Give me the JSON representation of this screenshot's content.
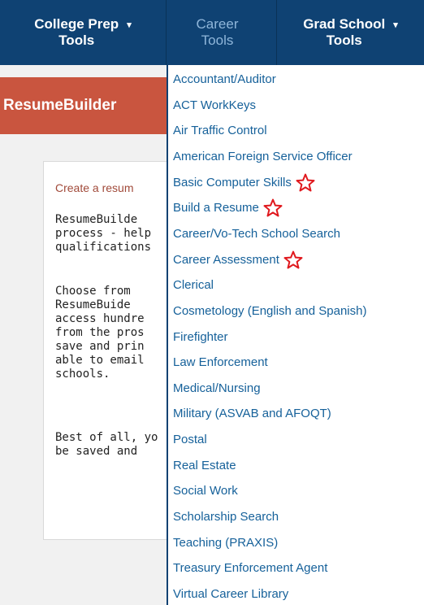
{
  "nav": {
    "tabs": [
      {
        "line1": "College Prep",
        "line2": "Tools",
        "has_caret": true
      },
      {
        "line1": "Career",
        "line2": "Tools",
        "active": true
      },
      {
        "line1": "Grad School",
        "line2": "Tools",
        "has_caret": true
      }
    ],
    "caret_glyph": "▾"
  },
  "banner": {
    "title": "ResumeBuilder"
  },
  "card": {
    "lead": "Create a resum",
    "p1": "ResumeBuilde\nprocess - help\nqualifications",
    "p2": "Choose from\nResumeBuide\naccess hundre\nfrom the pros\nsave and prin\nable to email\nschools.",
    "p3": "Best of all, yo\nbe saved and"
  },
  "dropdown": {
    "items": [
      {
        "label": "Accountant/Auditor"
      },
      {
        "label": "ACT WorkKeys"
      },
      {
        "label": "Air Traffic Control"
      },
      {
        "label": "American Foreign Service Officer"
      },
      {
        "label": "Basic Computer Skills",
        "starred": true
      },
      {
        "label": "Build a Resume",
        "starred": true
      },
      {
        "label": "Career/Vo-Tech School Search"
      },
      {
        "label": "Career Assessment",
        "starred": true
      },
      {
        "label": "Clerical"
      },
      {
        "label": "Cosmetology (English and Spanish)"
      },
      {
        "label": "Firefighter"
      },
      {
        "label": "Law Enforcement"
      },
      {
        "label": "Medical/Nursing"
      },
      {
        "label": "Military (ASVAB and AFOQT)"
      },
      {
        "label": "Postal"
      },
      {
        "label": "Real Estate"
      },
      {
        "label": "Social Work"
      },
      {
        "label": "Scholarship Search"
      },
      {
        "label": "Teaching (PRAXIS)"
      },
      {
        "label": "Treasury Enforcement Agent"
      },
      {
        "label": "Virtual Career Library"
      }
    ]
  },
  "colors": {
    "nav_bg": "#0f4273",
    "banner_bg": "#c9553f",
    "link": "#16619a",
    "star": "#e0191e"
  }
}
